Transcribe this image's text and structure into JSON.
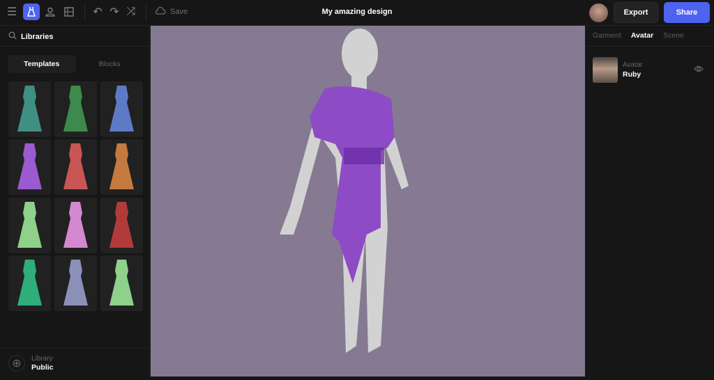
{
  "header": {
    "title": "My amazing design",
    "save_label": "Save",
    "export_label": "Export",
    "share_label": "Share",
    "accent": "#4e63f0"
  },
  "left_panel": {
    "search_label": "Libraries",
    "tabs": [
      {
        "label": "Templates",
        "active": true
      },
      {
        "label": "Blocks",
        "active": false
      }
    ],
    "templates": [
      "#3f8f82",
      "#3d8a4c",
      "#5c7bc4",
      "#9b5ad0",
      "#c95555",
      "#c47a3e",
      "#8fd08a",
      "#d488d0",
      "#b33a3a",
      "#2fae7a",
      "#8a90b8",
      "#8fd08a"
    ],
    "footer": {
      "label": "Library",
      "value": "Public"
    }
  },
  "viewport": {
    "background": "#857a92",
    "garment_color": "#8e4bc6"
  },
  "right_panel": {
    "tabs": [
      {
        "label": "Garment",
        "active": false
      },
      {
        "label": "Avatar",
        "active": true
      },
      {
        "label": "Scene",
        "active": false
      }
    ],
    "avatar": {
      "label": "Avatar",
      "name": "Ruby"
    }
  }
}
